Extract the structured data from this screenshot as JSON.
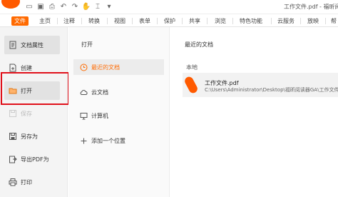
{
  "window": {
    "doc_title": "工作文件.pdf - 福昕阅"
  },
  "quick_access": [
    "folder-icon",
    "save-icon",
    "print-icon",
    "undo-icon",
    "redo-icon",
    "hand-icon",
    "select-icon",
    "more-icon"
  ],
  "tabs": [
    {
      "label": "文件",
      "active": true
    },
    {
      "label": "主页"
    },
    {
      "label": "注释"
    },
    {
      "label": "转换"
    },
    {
      "label": "视图"
    },
    {
      "label": "表单"
    },
    {
      "label": "保护"
    },
    {
      "label": "共享"
    },
    {
      "label": "浏览"
    },
    {
      "label": "特色功能"
    },
    {
      "label": "云服务"
    },
    {
      "label": "放映"
    },
    {
      "label": "帮"
    }
  ],
  "leftnav": [
    {
      "label": "文档属性",
      "icon": "document-icon"
    },
    {
      "label": "创建",
      "icon": "new-file-icon"
    },
    {
      "label": "打开",
      "icon": "open-folder-icon"
    },
    {
      "label": "保存",
      "icon": "save-icon"
    },
    {
      "label": "另存为",
      "icon": "save-as-icon"
    },
    {
      "label": "导出PDF为",
      "icon": "export-icon"
    },
    {
      "label": "打印",
      "icon": "print-icon"
    }
  ],
  "middle": {
    "heading": "打开",
    "items": [
      {
        "label": "最近的文档",
        "icon": "clock-icon"
      },
      {
        "label": "云文档",
        "icon": "cloud-icon"
      },
      {
        "label": "计算机",
        "icon": "computer-icon"
      },
      {
        "label": "添加一个位置",
        "icon": "plus-icon"
      }
    ]
  },
  "right": {
    "title": "最近的文档",
    "section": "本地",
    "file": {
      "name": "工作文件.pdf",
      "path": "C:\\Users\\Administrator\\Desktop\\福昕阅读器GA\\工作文件"
    }
  },
  "colors": {
    "accent": "#ff6a00",
    "highlight_box": "#e0101a"
  }
}
